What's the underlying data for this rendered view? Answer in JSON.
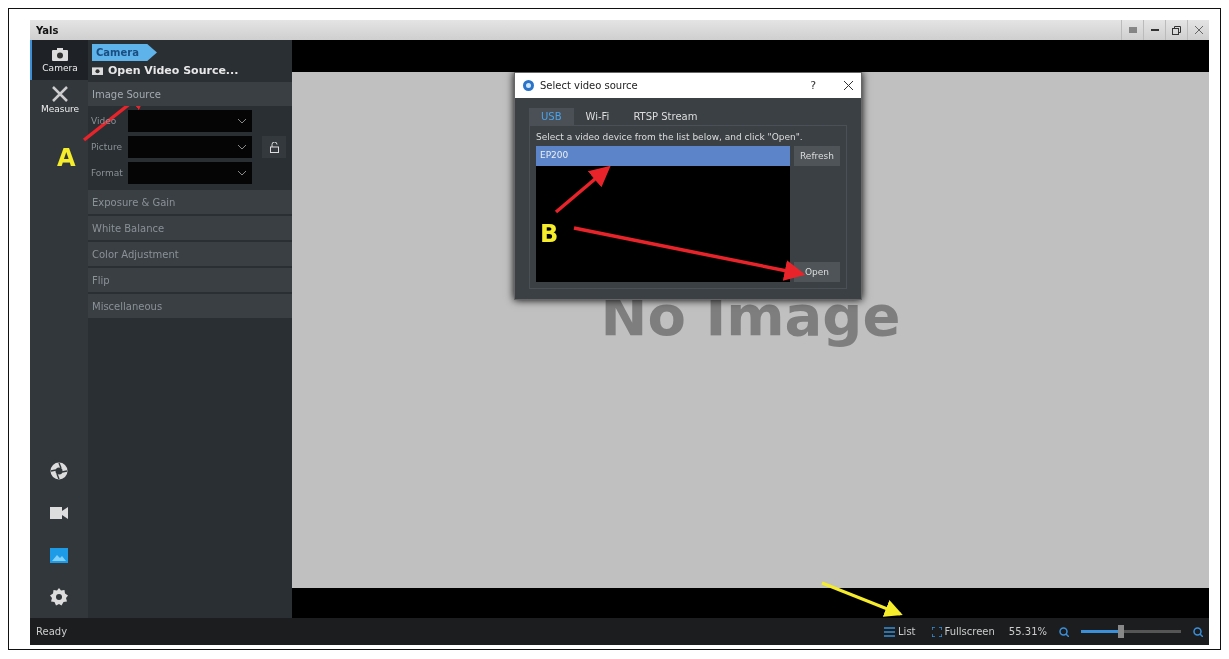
{
  "window": {
    "title": "Yals"
  },
  "rail": {
    "items": [
      {
        "label": "Camera",
        "kind": "camera",
        "selected": true
      },
      {
        "label": "Measure",
        "kind": "measure",
        "selected": false
      }
    ],
    "tools": [
      {
        "kind": "shutter",
        "selected": false
      },
      {
        "kind": "video",
        "selected": false
      },
      {
        "kind": "image",
        "selected": true
      },
      {
        "kind": "settings",
        "selected": false
      }
    ]
  },
  "panel": {
    "breadcrumb": "Camera",
    "action": "Open Video Source...",
    "sections": [
      {
        "title": "Image Source",
        "expanded": true,
        "fields": [
          {
            "label": "Video"
          },
          {
            "label": "Picture"
          },
          {
            "label": "Format"
          }
        ]
      },
      {
        "title": "Exposure & Gain",
        "expanded": false
      },
      {
        "title": "White Balance",
        "expanded": false
      },
      {
        "title": "Color Adjustment",
        "expanded": false
      },
      {
        "title": "Flip",
        "expanded": false
      },
      {
        "title": "Miscellaneous",
        "expanded": false
      }
    ]
  },
  "viewer": {
    "message": "No Image"
  },
  "dialog": {
    "title": "Select video source",
    "help": "?",
    "tabs": [
      {
        "label": "USB",
        "selected": true
      },
      {
        "label": "Wi-Fi",
        "selected": false
      },
      {
        "label": "RTSP Stream",
        "selected": false
      }
    ],
    "instruction": "Select a video device from the list below, and click \"Open\".",
    "devices": [
      {
        "name": "EP200",
        "selected": true
      }
    ],
    "buttons": [
      "Refresh",
      "Open"
    ]
  },
  "status_bar": {
    "text": "Ready",
    "list": "List",
    "fullscreen": "Fullscreen",
    "zoom": "55.31%",
    "zoom_slider": {
      "level": 0.4
    }
  },
  "annotations": [
    {
      "label": "A"
    },
    {
      "label": "B"
    }
  ]
}
